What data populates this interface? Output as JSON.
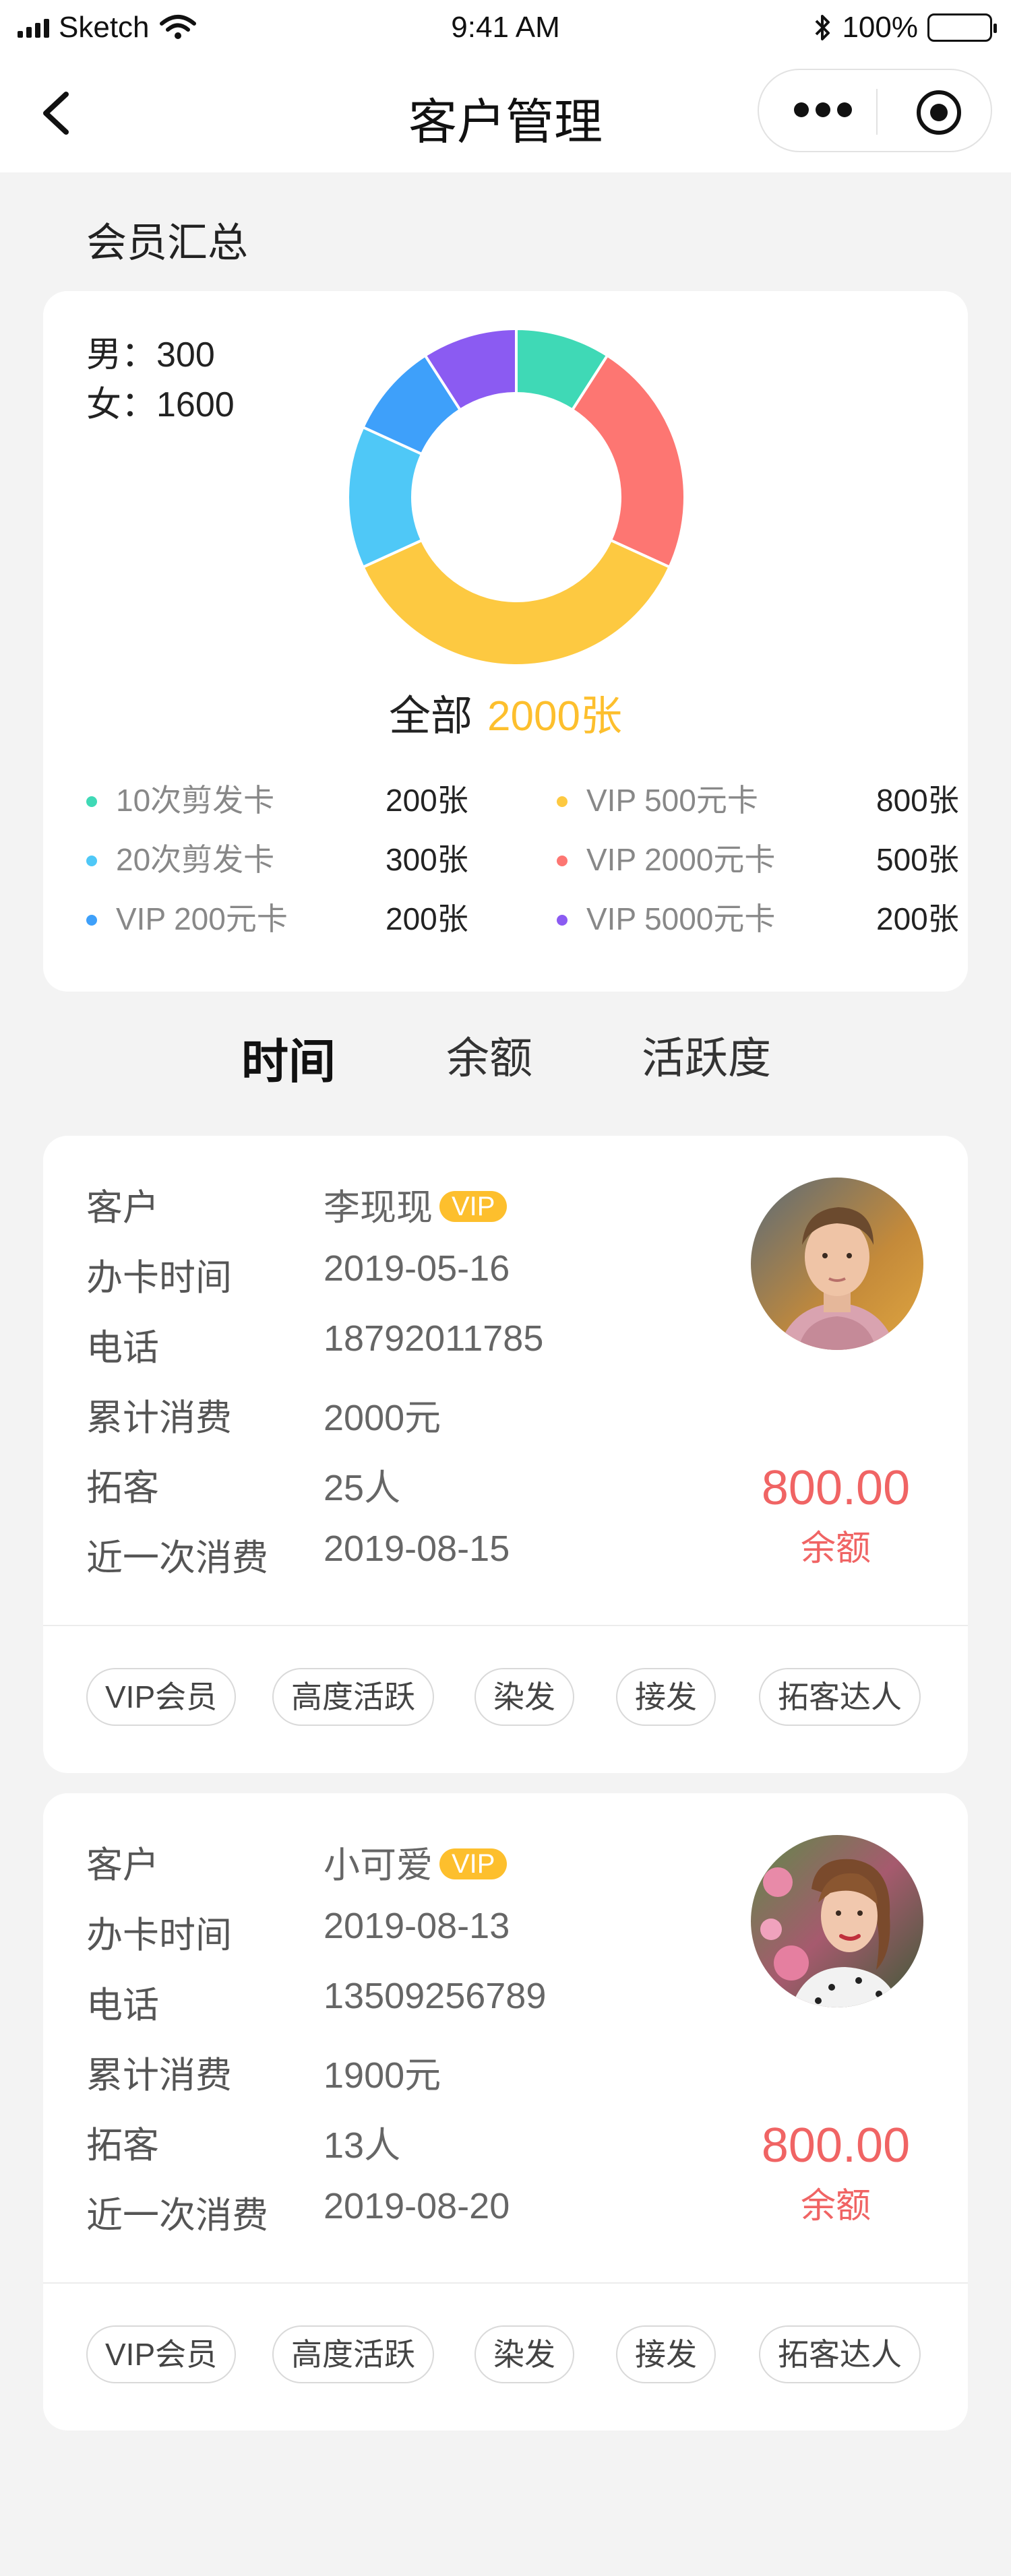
{
  "status_bar": {
    "carrier": "Sketch",
    "time": "9:41 AM",
    "battery": "100%"
  },
  "nav": {
    "title": "客户管理"
  },
  "summary": {
    "section_title": "会员汇总",
    "male_label": "男：300",
    "female_label": "女：1600",
    "total_label": "全部",
    "total_value": "2000张"
  },
  "chart_data": {
    "type": "pie",
    "donut": true,
    "categories": [
      "10次剪发卡",
      "20次剪发卡",
      "VIP 200元卡",
      "VIP 500元卡",
      "VIP 2000元卡",
      "VIP 5000元卡"
    ],
    "values": [
      200,
      300,
      200,
      800,
      500,
      200
    ],
    "legend_counts": [
      "200张",
      "300张",
      "200张",
      "800张",
      "500张",
      "200张"
    ],
    "colors": [
      "#3fd9b6",
      "#4fc8f7",
      "#3ea0fa",
      "#fdc941",
      "#fd7672",
      "#8b5bf2"
    ]
  },
  "tabs": [
    {
      "label": "时间",
      "active": true
    },
    {
      "label": "余额",
      "active": false
    },
    {
      "label": "活跃度",
      "active": false
    }
  ],
  "field_labels": {
    "customer": "客户",
    "card_date": "办卡时间",
    "phone": "电话",
    "total_spent": "累计消费",
    "referrals": "拓客",
    "last_purchase": "近一次消费"
  },
  "vip_badge": "VIP",
  "balance_label": "余额",
  "customers": [
    {
      "name": "李现现",
      "card_date": "2019-05-16",
      "phone": "18792011785",
      "total_spent": "2000元",
      "referrals": "25人",
      "last_purchase": "2019-08-15",
      "balance": "800.00",
      "tags": [
        "VIP会员",
        "高度活跃",
        "染发",
        "接发",
        "拓客达人"
      ]
    },
    {
      "name": "小可爱",
      "card_date": "2019-08-13",
      "phone": "13509256789",
      "total_spent": "1900元",
      "referrals": "13人",
      "last_purchase": "2019-08-20",
      "balance": "800.00",
      "tags": [
        "VIP会员",
        "高度活跃",
        "染发",
        "接发",
        "拓客达人"
      ]
    }
  ],
  "icons": {
    "back": "chevron-left-icon",
    "more": "more-icon",
    "target": "target-icon",
    "wifi": "wifi-icon",
    "bluetooth": "bluetooth-icon"
  }
}
